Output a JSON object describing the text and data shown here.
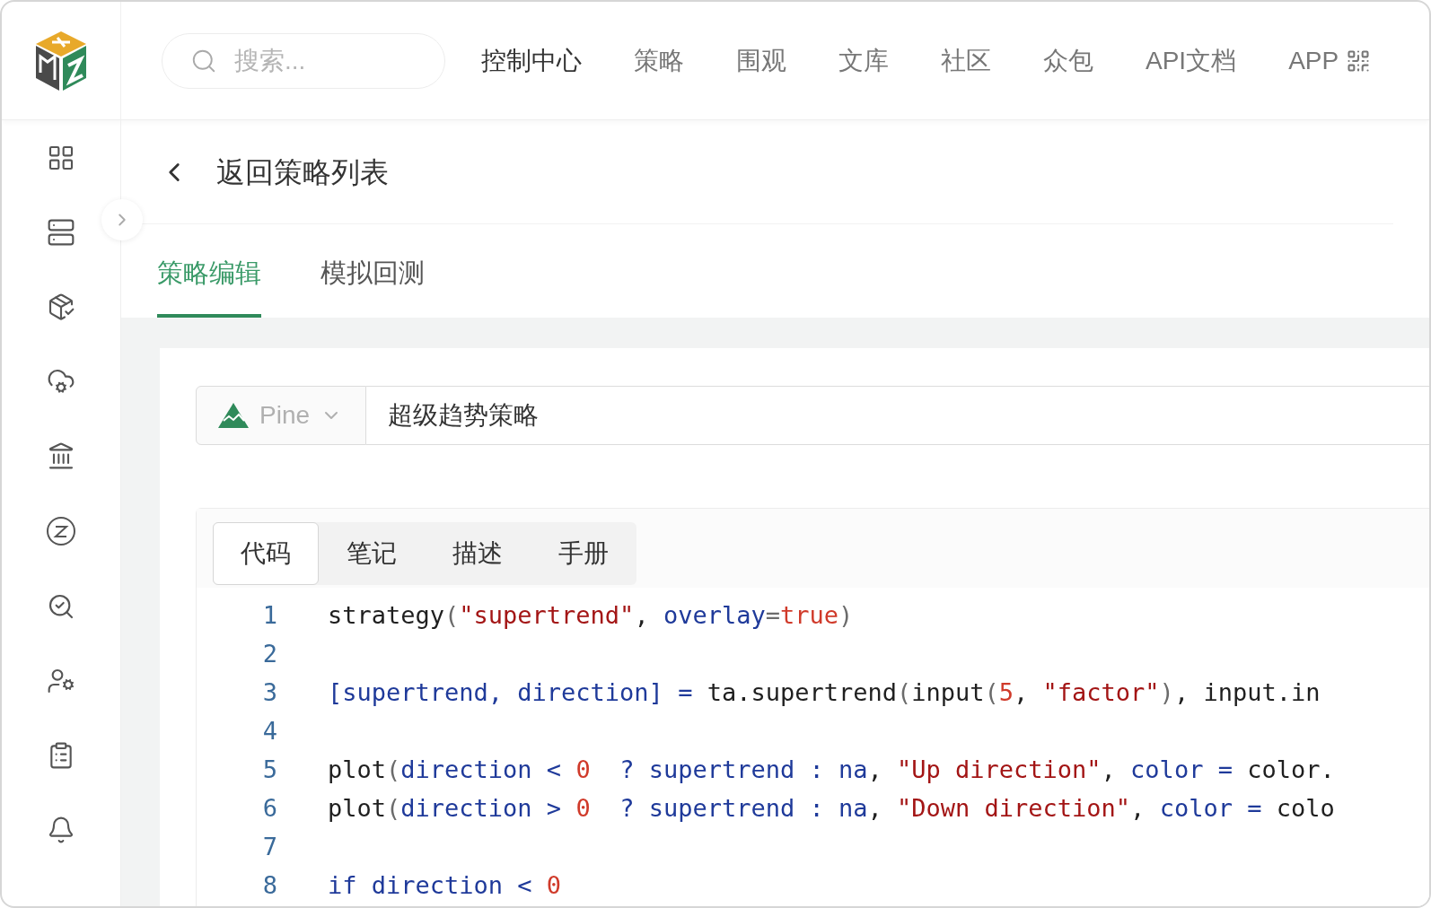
{
  "search": {
    "placeholder": "搜索..."
  },
  "nav": [
    {
      "label": "控制中心",
      "selected": true
    },
    {
      "label": "策略",
      "selected": false
    },
    {
      "label": "围观",
      "selected": false
    },
    {
      "label": "文库",
      "selected": false
    },
    {
      "label": "社区",
      "selected": false
    },
    {
      "label": "众包",
      "selected": false
    },
    {
      "label": "API文档",
      "selected": false
    },
    {
      "label": "APP",
      "selected": false
    }
  ],
  "back": {
    "label": "返回策略列表"
  },
  "tabs": [
    {
      "label": "策略编辑",
      "selected": true
    },
    {
      "label": "模拟回测",
      "selected": false
    }
  ],
  "language": {
    "label": "Pine"
  },
  "strategy_name": {
    "value": "超级趋势策略"
  },
  "editor_tabs": [
    {
      "label": "代码",
      "selected": true
    },
    {
      "label": "笔记",
      "selected": false
    },
    {
      "label": "描述",
      "selected": false
    },
    {
      "label": "手册",
      "selected": false
    }
  ],
  "code": [
    {
      "number": "1",
      "tokens": [
        {
          "kind": "plain",
          "text": "strategy"
        },
        {
          "kind": "paren",
          "text": "("
        },
        {
          "kind": "string",
          "text": "\"supertrend\""
        },
        {
          "kind": "plain",
          "text": ", "
        },
        {
          "kind": "ident",
          "text": "overlay"
        },
        {
          "kind": "paren",
          "text": "="
        },
        {
          "kind": "number",
          "text": "true"
        },
        {
          "kind": "paren",
          "text": ")"
        }
      ]
    },
    {
      "number": "2"
    },
    {
      "number": "3",
      "tokens": [
        {
          "kind": "ident",
          "text": "[supertrend, direction] = "
        },
        {
          "kind": "plain",
          "text": "ta.supertrend"
        },
        {
          "kind": "paren",
          "text": "("
        },
        {
          "kind": "plain",
          "text": "input"
        },
        {
          "kind": "paren",
          "text": "("
        },
        {
          "kind": "number",
          "text": "5"
        },
        {
          "kind": "plain",
          "text": ", "
        },
        {
          "kind": "string",
          "text": "\"factor\""
        },
        {
          "kind": "paren",
          "text": ")"
        },
        {
          "kind": "plain",
          "text": ", input.in"
        }
      ]
    },
    {
      "number": "4"
    },
    {
      "number": "5",
      "tokens": [
        {
          "kind": "plain",
          "text": "plot"
        },
        {
          "kind": "paren",
          "text": "("
        },
        {
          "kind": "ident",
          "text": "direction < "
        },
        {
          "kind": "number",
          "text": "0"
        },
        {
          "kind": "ident",
          "text": "  ? supertrend : na"
        },
        {
          "kind": "plain",
          "text": ", "
        },
        {
          "kind": "string",
          "text": "\"Up direction\""
        },
        {
          "kind": "plain",
          "text": ", "
        },
        {
          "kind": "ident",
          "text": "color = "
        },
        {
          "kind": "plain",
          "text": "color."
        }
      ]
    },
    {
      "number": "6",
      "tokens": [
        {
          "kind": "plain",
          "text": "plot"
        },
        {
          "kind": "paren",
          "text": "("
        },
        {
          "kind": "ident",
          "text": "direction > "
        },
        {
          "kind": "number",
          "text": "0"
        },
        {
          "kind": "ident",
          "text": "  ? supertrend : na"
        },
        {
          "kind": "plain",
          "text": ", "
        },
        {
          "kind": "string",
          "text": "\"Down direction\""
        },
        {
          "kind": "plain",
          "text": ", "
        },
        {
          "kind": "ident",
          "text": "color = "
        },
        {
          "kind": "plain",
          "text": "colo"
        }
      ]
    },
    {
      "number": "7"
    },
    {
      "number": "8",
      "tokens": [
        {
          "kind": "ident",
          "text": "if direction < "
        },
        {
          "kind": "number",
          "text": "0"
        }
      ]
    }
  ]
}
